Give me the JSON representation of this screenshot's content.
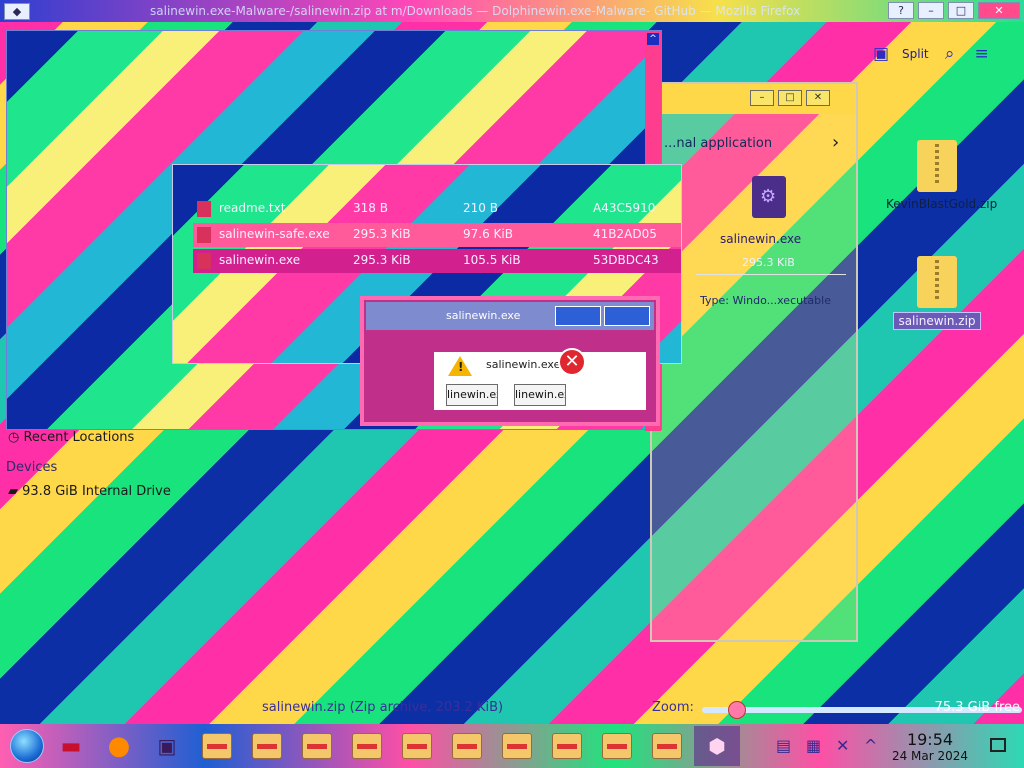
{
  "window": {
    "title": "salinewin.exe-Malware-/salinewin.zip at m/Downloads — Dolphinewin.exe-Malware- GitHub — Mozilla Firefox",
    "buttons": {
      "help": "?",
      "minimize": "–",
      "maximize": "□",
      "close": "✕"
    }
  },
  "browser_toolbar": {
    "split_label": "Split"
  },
  "dolphin": {
    "controls": [
      "–",
      "□",
      "✕"
    ],
    "subtitle": "Executable application",
    "subtitle_visible": "...nal application",
    "file_name": "salinewin.exe",
    "file_size": "295.3 KiB",
    "type_text": "Type: Windo...xecutable"
  },
  "desktop_icons": [
    {
      "label": "KevinBlastGold.zip"
    },
    {
      "label": "salinewin.zip"
    }
  ],
  "file_list": {
    "rows": [
      {
        "name": "readme.txt",
        "size": "318 B",
        "packed": "210 B",
        "crc": "A43C5910"
      },
      {
        "name": "salinewin-safe.exe",
        "size": "295.3 KiB",
        "packed": "97.6 KiB",
        "crc": "41B2AD05"
      },
      {
        "name": "salinewin.exe",
        "size": "295.3 KiB",
        "packed": "105.5 KiB",
        "crc": "53DBDC43"
      }
    ]
  },
  "error_dialog": {
    "title": "salinewin.exe",
    "message": "salinewin.exe",
    "button1": "linewin.exe",
    "button2": "linewin.exe"
  },
  "sidebar": {
    "recent": "Recent Locations",
    "devices_header": "Devices",
    "drive": "93.8 GiB Internal Drive"
  },
  "status": {
    "file_info": "salinewin.zip (Zip archive, 203.2 KiB)",
    "zoom_label": "Zoom:",
    "free_space": "75.3 GiB free",
    "zoom_level": 0.08
  },
  "taskbar": {
    "time": "19:54",
    "date": "24 Mar 2024"
  }
}
